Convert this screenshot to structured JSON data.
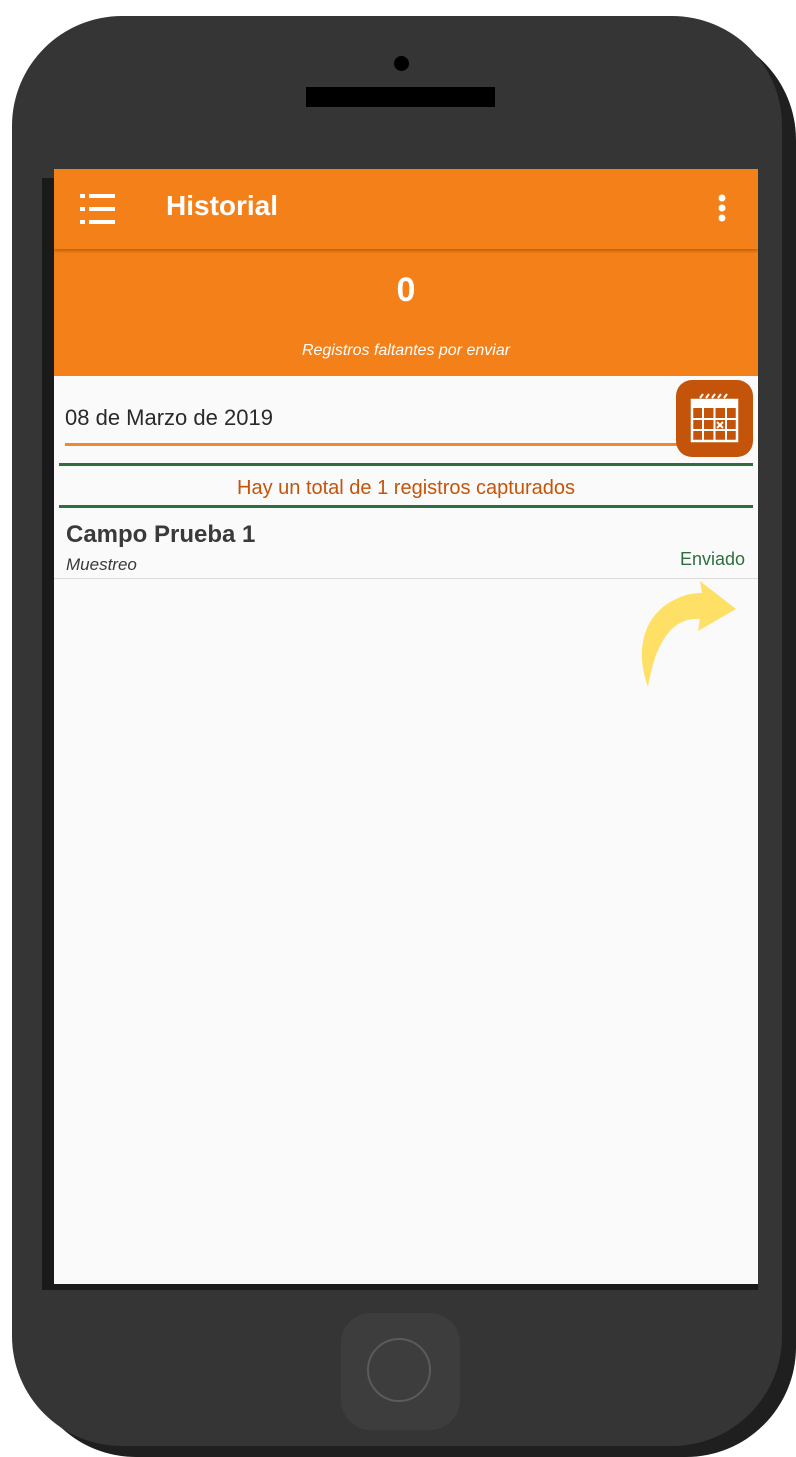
{
  "appbar": {
    "title": "Historial",
    "menu_icon": "list-menu-icon",
    "more_icon": "more-vert-icon"
  },
  "summary": {
    "pending_count": "0",
    "pending_label": "Registros faltantes por enviar"
  },
  "date_filter": {
    "value": "08 de Marzo de 2019",
    "calendar_icon": "calendar-icon"
  },
  "records": {
    "total_text": "Hay un total de 1 registros capturados",
    "items": [
      {
        "title": "Campo Prueba 1",
        "subtitle": "Muestreo",
        "status": "Enviado"
      }
    ]
  },
  "colors": {
    "primary": "#f48019",
    "accent_dark": "#c4540a",
    "success_green": "#2e6e3f",
    "highlight_arrow": "#ffe066",
    "phone_body": "#353535"
  }
}
